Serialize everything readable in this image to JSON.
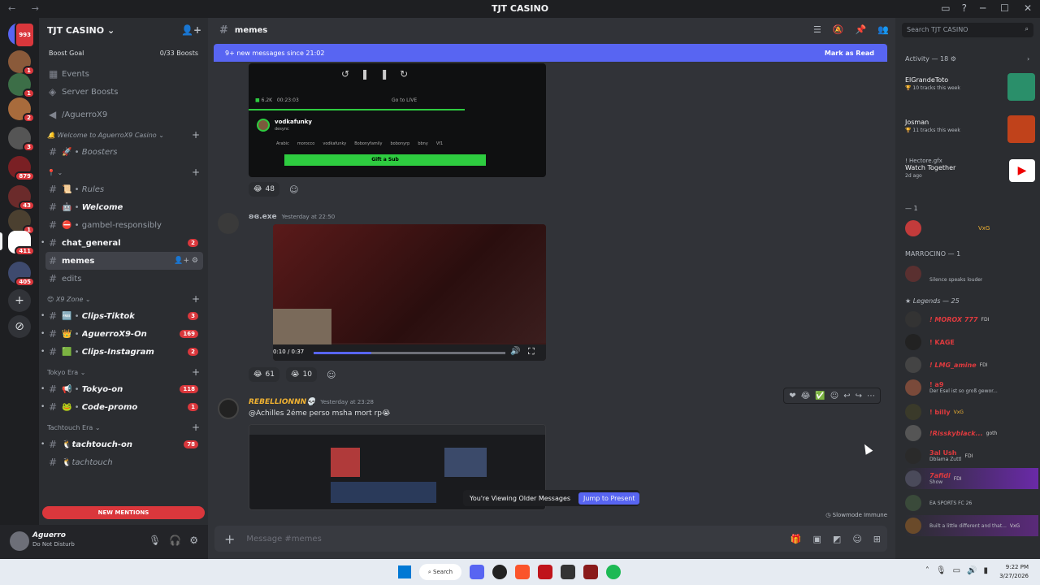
{
  "window": {
    "title": "TJT CASINO",
    "nav_glyph": "← →",
    "controls": [
      "─",
      "☐",
      "✕"
    ],
    "tool_icons": [
      "▭",
      "?"
    ]
  },
  "server_list": {
    "badges": [
      "993",
      "1",
      "1",
      "2",
      "3",
      "879",
      "43",
      "1",
      "411",
      "405"
    ]
  },
  "guild": {
    "name": "TJT CASINO",
    "boost_goal_label": "Boost Goal",
    "boost_count": "0/33 Boosts",
    "top_links": [
      {
        "label": "Events",
        "icon": "▦"
      },
      {
        "label": "Server Boosts",
        "icon": "◈"
      },
      {
        "label": "/AguerroX9",
        "icon": "◀"
      }
    ],
    "categories": [
      {
        "label": "🔔 Welcome to AguerroX9 Casino"
      },
      {
        "label": "📍"
      },
      {
        "label": "😊 X9 Zone"
      },
      {
        "label": "Tokyo Era"
      },
      {
        "label": "Tachtouch Era"
      }
    ],
    "channels": [
      {
        "label": "Boosters",
        "prefix": "🚀 •"
      },
      {
        "label": "Rules",
        "prefix": "📜 •"
      },
      {
        "label": "Welcome",
        "prefix": "🤖 •"
      },
      {
        "label": "gambel-responsibly",
        "prefix": "⛔ •"
      },
      {
        "label": "chat_general",
        "count": "2"
      },
      {
        "label": "memes"
      },
      {
        "label": "edits"
      },
      {
        "label": "Clips-Tiktok",
        "prefix": "🆓 •",
        "count": "3"
      },
      {
        "label": "AguerroX9-On",
        "prefix": "👑 •",
        "count": "169"
      },
      {
        "label": "Clips-Instagram",
        "prefix": "🟩 •",
        "count": "2"
      },
      {
        "label": "Tokyo-on",
        "prefix": "📢 •",
        "count": "118"
      },
      {
        "label": "Code-promo",
        "prefix": "🐸 •",
        "count": "1"
      },
      {
        "label": "tachtouch-on",
        "prefix": "🐧",
        "count": "78"
      },
      {
        "label": "tachtouch",
        "prefix": "🐧"
      }
    ],
    "new_mentions": "NEW MENTIONS"
  },
  "user": {
    "name": "Aguerro",
    "status": "Do Not Disturb"
  },
  "channel": {
    "name": "memes",
    "new_messages_text": "9+ new messages since 21:02",
    "mark_as_read": "Mark as Read"
  },
  "messages": {
    "stream_card": {
      "streamer": "vodkafunky",
      "subtitle": "desync",
      "viewers": "6.2K",
      "elapsed": "00:23:03",
      "go_live": "Go to LIVE",
      "tags": [
        "Arabic",
        "morocco",
        "vodkafunky",
        "Bobonyfamily",
        "bobonyrp",
        "bbny",
        "Vf1"
      ],
      "gift_label": "Gift a Sub"
    },
    "reactions_1": [
      {
        "emoji": "😂",
        "count": "48"
      }
    ],
    "msg2": {
      "author": "ʚɞ.exe",
      "time": "Yesterday at 22:50",
      "video_time": "0:10 / 0:37"
    },
    "reactions_2": [
      {
        "emoji": "😂",
        "count": "61"
      },
      {
        "emoji": "😭",
        "count": "10"
      }
    ],
    "msg3": {
      "author": "REBELLIONNN💀",
      "time": "Yesterday at 23:28",
      "text": "@Achilles 2éme perso msha mort rp😭"
    },
    "older_notice": "You're Viewing Older Messages",
    "jump_label": "Jump to Present",
    "slowmode": "Slowmode Immune",
    "composer_placeholder": "Message #memes"
  },
  "sidebar": {
    "search_placeholder": "Search TJT CASINO",
    "activity_header": "Activity — 18",
    "activities": [
      {
        "name": "ElGrandeToto",
        "sub": "🏆 10 tracks this week",
        "thumb_color": "#2a8f6a"
      },
      {
        "name": "Josman",
        "sub": "🏆 11 tracks this week",
        "thumb_color": "#c0421b"
      },
      {
        "name": "Watch Together",
        "sub": "2d ago",
        "owner": "! Hectore.gfx",
        "thumb_color": "#ffffff"
      }
    ],
    "group_1_header": "— 1",
    "marrocino_header": "MARROCINO — 1",
    "member_vxg": {
      "name": "VxG"
    },
    "member_silence": {
      "sub": "Silence speaks louder"
    },
    "legends_header": "Legends — 25",
    "members": [
      {
        "name": "! MOROX 777",
        "tag": "FDI",
        "color": "#e03a3e"
      },
      {
        "name": "! KAGE",
        "color": "#e03a3e"
      },
      {
        "name": "! LMG_amine",
        "tag": "FDI",
        "color": "#e03a3e"
      },
      {
        "name": "! a9",
        "sub": "Der Esel ist so groß gewor...",
        "color": "#e03a3e"
      },
      {
        "name": "! billy",
        "tag": "VxG",
        "color": "#e03a3e"
      },
      {
        "name": "!Risskyblack...",
        "tag": "goth",
        "color": "#e03a3e"
      },
      {
        "name": "3al Ush",
        "tag": "FDI",
        "sub": "Dblama Zuttl",
        "color": "#e03a3e"
      },
      {
        "name": "7afidi",
        "tag": "FDI",
        "sub": "Show",
        "color": "#e03a3e"
      },
      {
        "name": "",
        "sub": "EA SPORTS FC 26",
        "color": "#e03a3e"
      },
      {
        "name": "",
        "tag": "VxG",
        "sub": "Built a little different and that...",
        "color": "#e03a3e"
      }
    ]
  },
  "taskbar": {
    "search": "Search",
    "time": "9:22 PM",
    "date": "3/27/2026"
  }
}
